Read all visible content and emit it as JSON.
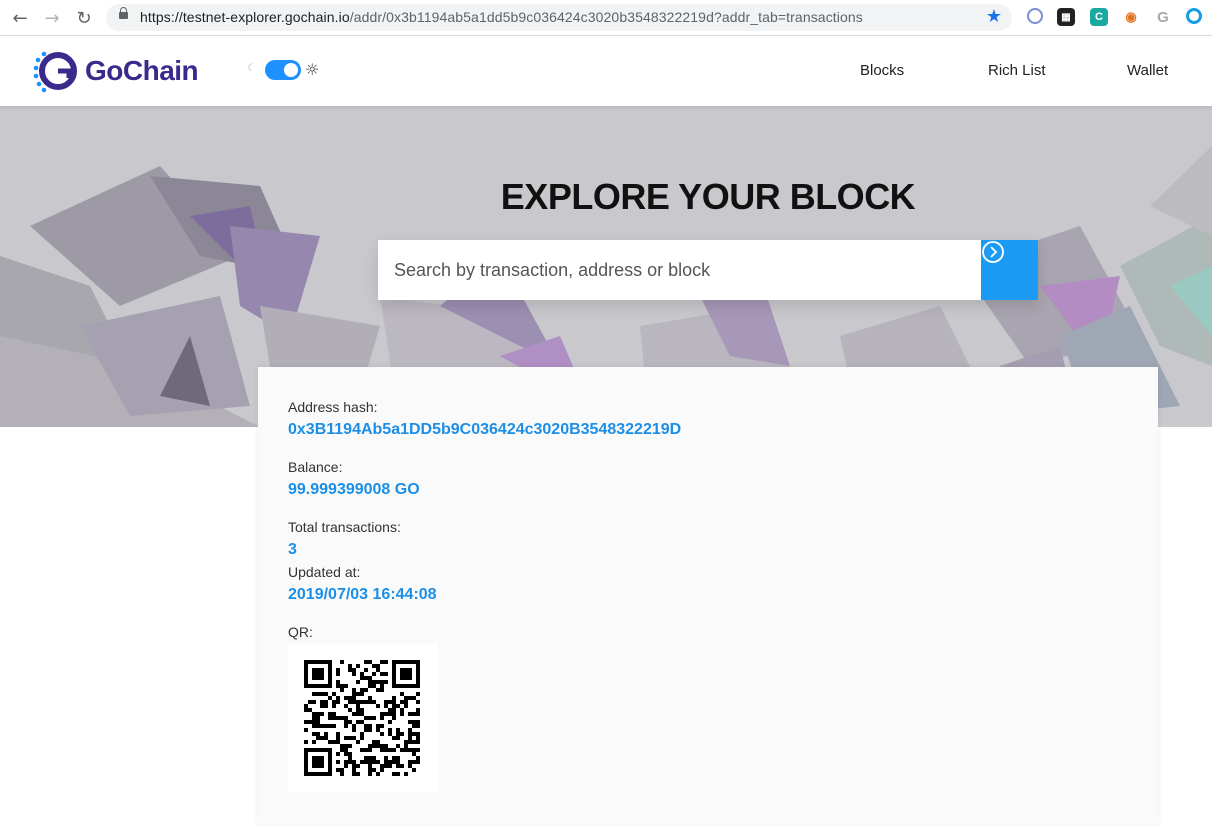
{
  "browser": {
    "url_host": "https://testnet-explorer.gochain.io",
    "url_path": "/addr/0x3b1194ab5a1dd5b9c036424c3020b3548322219d?addr_tab=transactions",
    "back_icon": "arrow-left-icon",
    "forward_icon": "arrow-right-icon",
    "reload_icon": "reload-icon",
    "bookmark_icon": "star-icon"
  },
  "header": {
    "logo_text": "GoChain",
    "nav": [
      {
        "label": "Blocks"
      },
      {
        "label": "Rich List"
      },
      {
        "label": "Wallet"
      }
    ],
    "theme_toggle_on": true
  },
  "hero": {
    "title": "EXPLORE YOUR BLOCK",
    "search_placeholder": "Search by transaction, address or block"
  },
  "address": {
    "hash_label": "Address hash:",
    "hash_value": "0x3B1194Ab5a1DD5b9C036424c3020B3548322219D",
    "balance_label": "Balance:",
    "balance_value": "99.999399008 GO",
    "total_tx_label": "Total transactions:",
    "total_tx_value": "3",
    "updated_label": "Updated at:",
    "updated_value": "2019/07/03 16:44:08",
    "qr_label": "QR:"
  },
  "colors": {
    "accent": "#1b9cf2",
    "value_text": "#1b8fe8",
    "logo": "#3a2a8c"
  }
}
